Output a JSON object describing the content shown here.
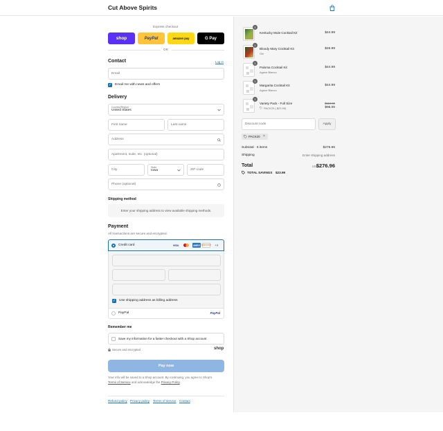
{
  "header": {
    "store_name": "Cut Above Spirits",
    "cart_icon": "shopping-bag-icon"
  },
  "express": {
    "label": "Express checkout",
    "shop": "shop",
    "paypal": "PayPal",
    "amazon": "amazon pay",
    "gpay": "G Pay",
    "or": "OR"
  },
  "contact": {
    "title": "Contact",
    "login": "Log in",
    "email_placeholder": "Email",
    "news_label": "Email me with news and offers"
  },
  "delivery": {
    "title": "Delivery",
    "country_label": "Country/Region",
    "country_value": "United States",
    "first_name": "First name",
    "last_name": "Last name",
    "address": "Address",
    "apartment": "Apartment, suite, etc. (optional)",
    "city": "City",
    "state_label": "State",
    "state_value": "Iowa",
    "zip": "ZIP code",
    "phone": "Phone (optional)"
  },
  "shipping": {
    "title": "Shipping method",
    "notice": "Enter your shipping address to view available shipping methods."
  },
  "payment": {
    "title": "Payment",
    "subtitle": "All transactions are secure and encrypted.",
    "credit_card": "Credit card",
    "cards": [
      "VISA",
      "MC",
      "AMEX",
      "DISCOVER"
    ],
    "more_cards": "+4",
    "billing_label": "Use shipping address as billing address",
    "paypal_label": "PayPal",
    "paypal_logo": "PayPal"
  },
  "remember": {
    "title": "Remember me",
    "save_label": "Save my information for a faster checkout with a Shop account",
    "secure": "Secure and encrypted",
    "shop_logo": "shop"
  },
  "pay_now": "Pay now",
  "legal": {
    "text1": "Your info will be saved to a Shop account. By continuing, you agree to Shop's",
    "terms": "Terms of Service",
    "text2": "and acknowledge the",
    "privacy": "Privacy Policy",
    "text3": "."
  },
  "footer_links": [
    "Refund policy",
    "Privacy policy",
    "Terms of service",
    "Contact"
  ],
  "order": {
    "items": [
      {
        "name": "Kentucky Mule Cocktail Kit",
        "sub": "",
        "price": "$44.99",
        "orig": "",
        "qty": "1"
      },
      {
        "name": "Bloody Mary Cocktail Kit",
        "sub": "Gin",
        "price": "$45.99",
        "orig": "",
        "qty": "1"
      },
      {
        "name": "Paloma Cocktail Kit",
        "sub": "Agave Blanco",
        "price": "$44.99",
        "orig": "",
        "qty": "1"
      },
      {
        "name": "Margarita Cocktail Kit",
        "sub": "Agave Blanco",
        "price": "$44.99",
        "orig": "",
        "qty": "1"
      },
      {
        "name": "Variety Pack - Full Size",
        "sub": "PACK20 (-$23.99)",
        "price": "$96.00",
        "orig": "$119.99",
        "qty": "1"
      }
    ],
    "discount_placeholder": "Discount code",
    "apply": "Apply",
    "code_tag": "PACK20",
    "subtotal_label": "Subtotal · 5 items",
    "subtotal_value": "$276.96",
    "shipping_label": "Shipping",
    "shipping_value": "Enter shipping address",
    "total_label": "Total",
    "currency": "USD",
    "total_value": "$276.96",
    "savings_label": "TOTAL SAVINGS",
    "savings_value": "$23.99"
  },
  "colors": {
    "accent": "#1773b0",
    "shop": "#5a31f4",
    "paypal": "#ffc439",
    "amazon": "#ffd814",
    "pay_btn": "#8fb5e3"
  }
}
